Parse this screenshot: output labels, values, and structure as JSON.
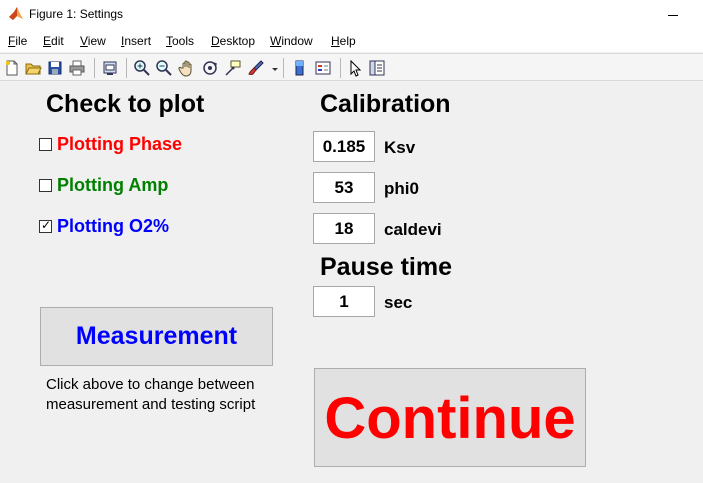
{
  "window": {
    "title": "Figure 1: Settings"
  },
  "menu": [
    {
      "underline": "F",
      "rest": "ile"
    },
    {
      "underline": "E",
      "rest": "dit"
    },
    {
      "underline": "V",
      "rest": "iew"
    },
    {
      "underline": "I",
      "rest": "nsert"
    },
    {
      "underline": "T",
      "rest": "ools"
    },
    {
      "underline": "D",
      "rest": "esktop"
    },
    {
      "underline": "W",
      "rest": "indow"
    },
    {
      "underline": "H",
      "rest": "elp"
    }
  ],
  "toolbar": {
    "icons": [
      "new-figure-icon",
      "open-file-icon",
      "save-icon",
      "print-icon",
      "link-plot-icon",
      "zoom-in-icon",
      "zoom-out-icon",
      "pan-icon",
      "rotate-3d-icon",
      "data-cursor-icon",
      "brush-icon",
      "colorbar-icon",
      "legend-icon",
      "edit-plot-icon",
      "property-inspector-icon"
    ]
  },
  "plot_section": {
    "heading": "Check to plot",
    "options": [
      {
        "label": "Plotting Phase",
        "checked": false,
        "color": "#ff0000"
      },
      {
        "label": "Plotting Amp",
        "checked": false,
        "color": "#008000"
      },
      {
        "label": "Plotting O2%",
        "checked": true,
        "color": "#0000ff"
      }
    ]
  },
  "calibration": {
    "heading": "Calibration",
    "fields": [
      {
        "value": "0.185",
        "label": "Ksv"
      },
      {
        "value": "53",
        "label": "phi0"
      },
      {
        "value": "18",
        "label": "caldevi"
      }
    ]
  },
  "pause": {
    "heading": "Pause time",
    "value": "1",
    "label": "sec"
  },
  "mode_button": {
    "label": "Measurement",
    "color": "#0000ff"
  },
  "hint": {
    "line1": "Click above to change between",
    "line2": "measurement and testing script"
  },
  "continue_button": {
    "label": "Continue",
    "color": "#ff0000"
  }
}
